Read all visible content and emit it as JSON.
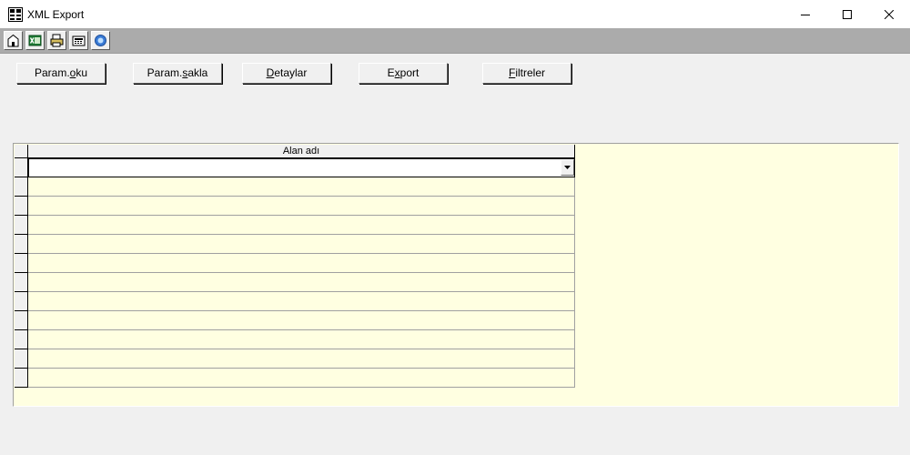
{
  "window": {
    "title": "XML Export",
    "icon": "app-grid-icon",
    "controls": [
      "minimize-icon",
      "maximize-icon",
      "close-icon"
    ]
  },
  "toolbar": {
    "icons": [
      "home-icon",
      "excel-icon",
      "print-icon",
      "calculator-icon",
      "help-icon"
    ]
  },
  "actions": [
    {
      "before": "Param.",
      "accel": "o",
      "after": "ku"
    },
    {
      "before": "Param.",
      "accel": "s",
      "after": "akla"
    },
    {
      "before": "",
      "accel": "D",
      "after": "etaylar"
    },
    {
      "before": "E",
      "accel": "x",
      "after": "port"
    },
    {
      "before": "",
      "accel": "F",
      "after": "iltreler"
    }
  ],
  "grid": {
    "column_header": "Alan adı",
    "active_cell_value": "",
    "row_count": 12
  },
  "colors": {
    "grid_background": "#ffffe1",
    "window_background": "#f0f0f0",
    "toolbar_background": "#ababab"
  }
}
